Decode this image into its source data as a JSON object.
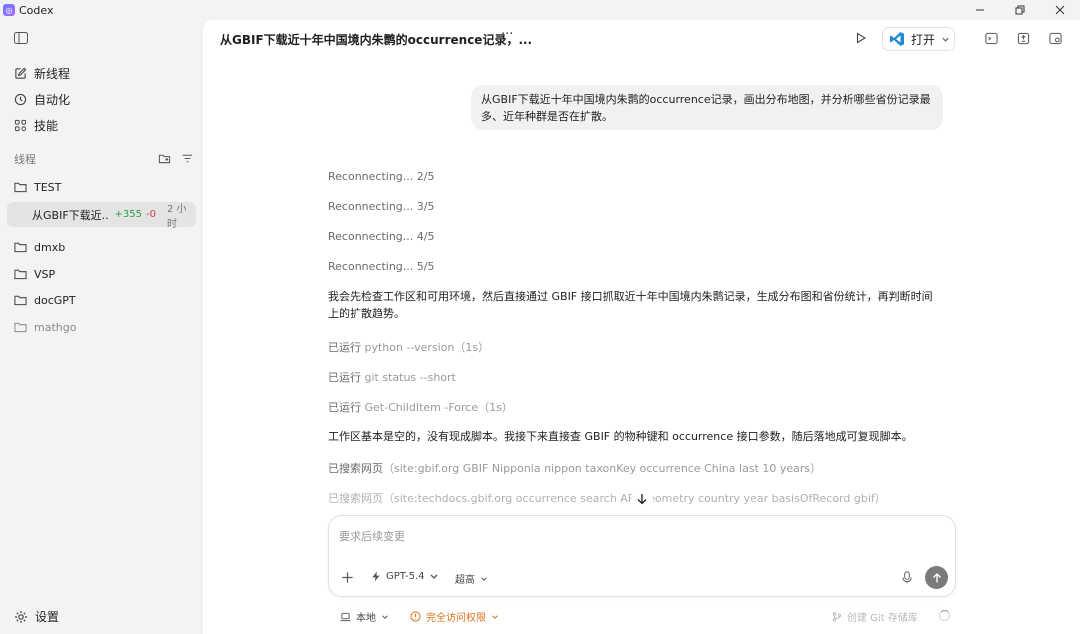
{
  "window": {
    "app_title": "Codex"
  },
  "sidebar": {
    "nav": [
      {
        "label": "新线程",
        "icon": "edit-icon"
      },
      {
        "label": "自动化",
        "icon": "clock-icon"
      },
      {
        "label": "技能",
        "icon": "grid-icon"
      }
    ],
    "threads_label": "线程",
    "folders_top": [
      {
        "label": "TEST"
      }
    ],
    "active_thread": {
      "title": "从GBIF下载近...",
      "additions": "+355",
      "deletions": "-0",
      "time": "2 小时"
    },
    "folders": [
      {
        "label": "dmxb"
      },
      {
        "label": "VSP"
      },
      {
        "label": "docGPT"
      },
      {
        "label": "mathgo"
      }
    ],
    "settings_label": "设置"
  },
  "header": {
    "title": "从GBIF下载近十年中国境内朱鹮的occurrence记录，...",
    "more": "···",
    "open_label": "打开"
  },
  "chat": {
    "user_message": "从GBIF下载近十年中国境内朱鹮的occurrence记录，画出分布地图，并分析哪些省份记录最多、近年种群是否在扩散。",
    "reconnecting": [
      "Reconnecting... 2/5",
      "Reconnecting... 3/5",
      "Reconnecting... 4/5",
      "Reconnecting... 5/5"
    ],
    "reply_1": "我会先检查工作区和可用环境，然后直接通过 GBIF 接口抓取近十年中国境内朱鹮记录，生成分布图和省份统计，再判断时间上的扩散趋势。",
    "ran_prefix": "已运行",
    "runs": [
      {
        "cmd": "python --version",
        "duration": "（1s）"
      },
      {
        "cmd": "git status --short",
        "duration": ""
      },
      {
        "cmd": "Get-ChildItem -Force",
        "duration": "（1s）"
      }
    ],
    "reply_2": "工作区基本是空的，没有现成脚本。我接下来直接查 GBIF 的物种键和 occurrence 接口参数，随后落地成可复现脚本。",
    "search_prefix": "已搜索网页",
    "searches": [
      "（site:gbif.org GBIF Nipponia nippon taxonKey occurrence China last 10 years）",
      "（site:techdocs.gbif.org occurrence search API geometry country year basisOfRecord gbif）"
    ]
  },
  "composer": {
    "placeholder": "要求后续变更",
    "model": "GPT-5.4",
    "effort": "超高"
  },
  "footer": {
    "local": "本地",
    "access": "完全访问权限",
    "git": "创建 Git 存储库"
  }
}
